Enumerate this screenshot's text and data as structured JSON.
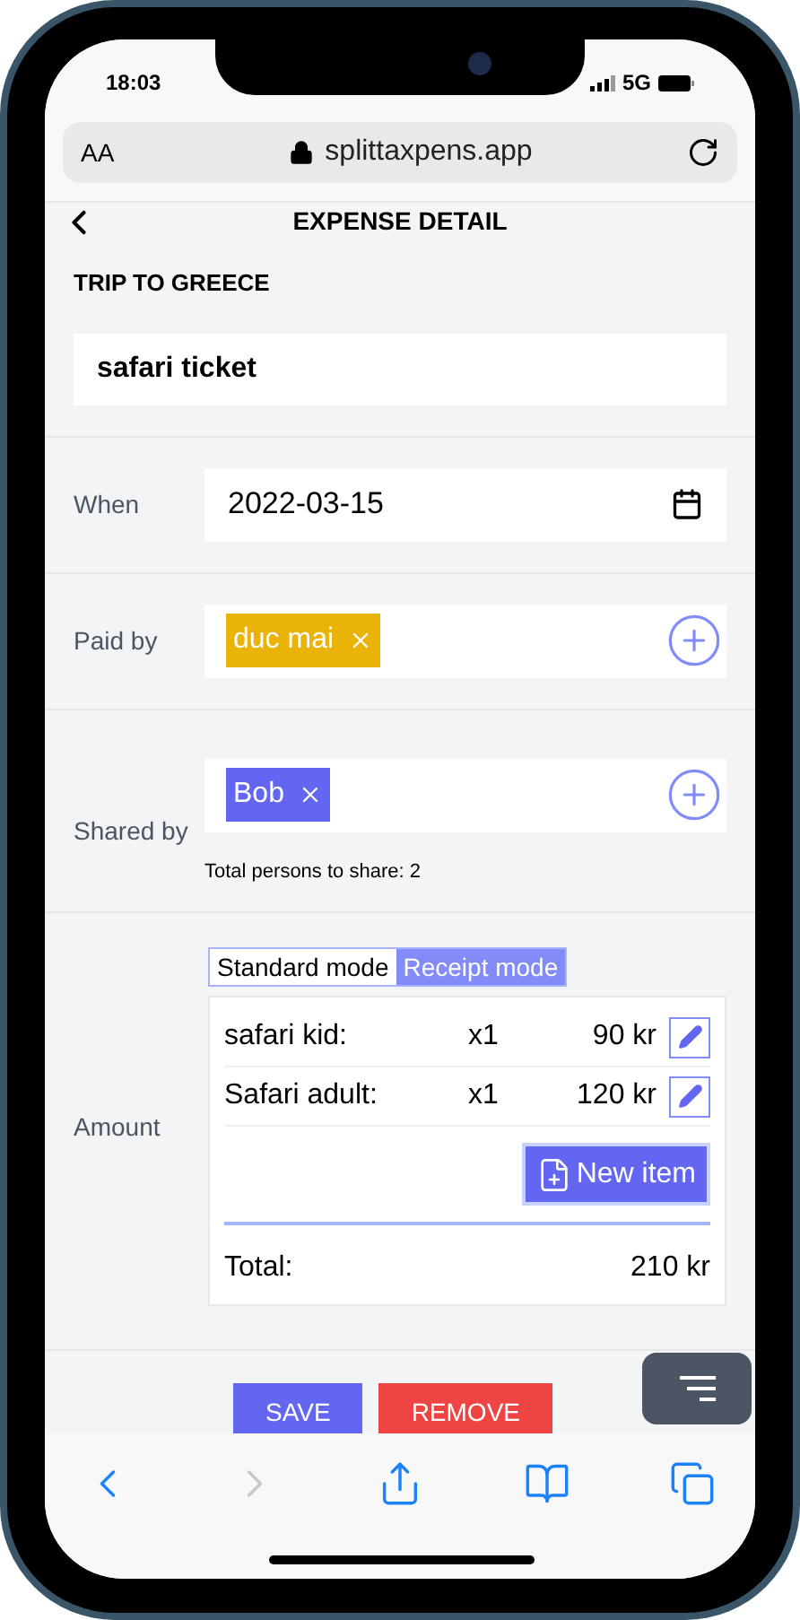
{
  "status_bar": {
    "time": "18:03",
    "network": "5G"
  },
  "address_bar": {
    "text_size": "AA",
    "url": "splittaxpens.app"
  },
  "header": {
    "title": "EXPENSE DETAIL"
  },
  "group": {
    "title": "TRIP TO GREECE"
  },
  "expense_name": {
    "value": "safari ticket"
  },
  "when": {
    "label": "When",
    "value": "2022-03-15"
  },
  "paid_by": {
    "label": "Paid by",
    "people": [
      {
        "name": "duc mai",
        "color": "#e9b307"
      }
    ]
  },
  "shared_by": {
    "label": "Shared by",
    "people": [
      {
        "name": "Bob",
        "color": "#6366f1"
      }
    ],
    "note": "Total persons to share: 2"
  },
  "amount": {
    "label": "Amount",
    "modes": [
      {
        "label": "Standard mode",
        "selected": false
      },
      {
        "label": "Receipt mode",
        "selected": true
      }
    ],
    "items": [
      {
        "name": "safari kid:",
        "quantity": "x1",
        "price": "90 kr"
      },
      {
        "name": "Safari adult:",
        "quantity": "x1",
        "price": "120 kr"
      }
    ],
    "new_item": "New item",
    "total_label": "Total:",
    "total_value": "210 kr"
  },
  "actions": [
    {
      "label": "SAVE",
      "kind": "primary"
    },
    {
      "label": "REMOVE",
      "kind": "danger"
    }
  ],
  "toolbar": [
    {
      "kind": "back",
      "disabled": false
    },
    {
      "kind": "forward",
      "disabled": true
    },
    {
      "kind": "share",
      "disabled": false
    },
    {
      "kind": "bookmarks",
      "disabled": false
    },
    {
      "kind": "tabs",
      "disabled": false
    }
  ]
}
